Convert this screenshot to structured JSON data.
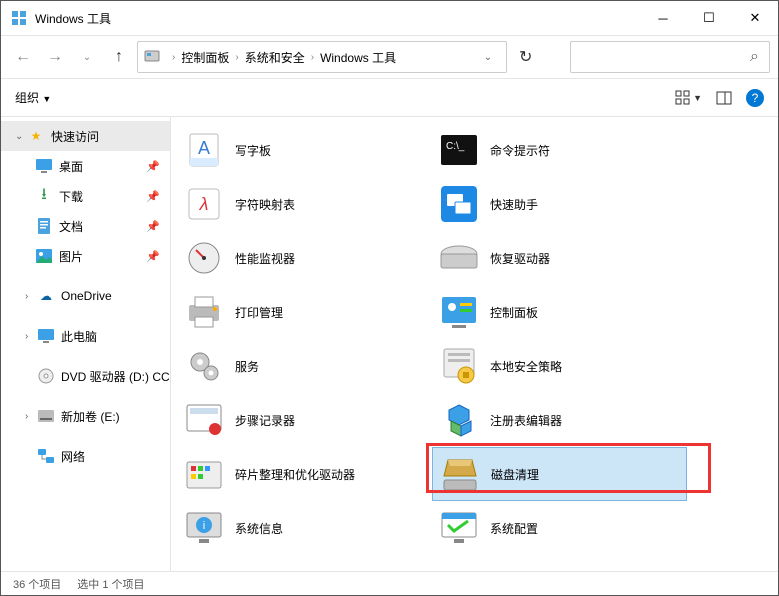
{
  "window": {
    "title": "Windows 工具"
  },
  "breadcrumb": {
    "root": "控制面板",
    "mid": "系统和安全",
    "leaf": "Windows 工具"
  },
  "toolbar": {
    "organize": "组织"
  },
  "sidebar": {
    "quick": "快速访问",
    "desktop": "桌面",
    "downloads": "下载",
    "documents": "文档",
    "pictures": "图片",
    "onedrive": "OneDrive",
    "thispc": "此电脑",
    "dvd": "DVD 驱动器 (D:) CC",
    "volume": "新加卷 (E:)",
    "network": "网络"
  },
  "items": {
    "left": [
      "写字板",
      "字符映射表",
      "性能监视器",
      "打印管理",
      "服务",
      "步骤记录器",
      "碎片整理和优化驱动器",
      "系统信息"
    ],
    "right": [
      "命令提示符",
      "快速助手",
      "恢复驱动器",
      "控制面板",
      "本地安全策略",
      "注册表编辑器",
      "磁盘清理",
      "系统配置"
    ]
  },
  "status": {
    "count": "36 个项目",
    "selected": "选中 1 个项目"
  }
}
